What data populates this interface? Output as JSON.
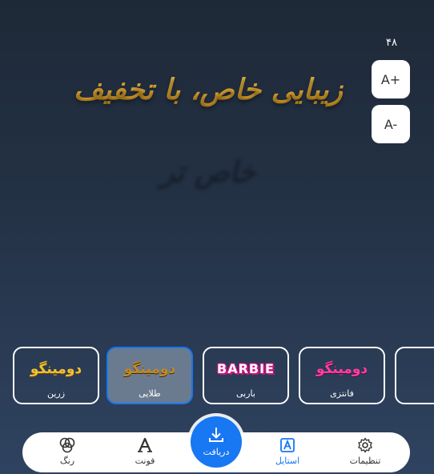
{
  "font_size": {
    "value": "۴۸",
    "increase_label": "A+",
    "decrease_label": "A-"
  },
  "preview": {
    "text": "زیبایی خاص، با تخفیف خاص تر"
  },
  "styles": [
    {
      "preview": "دومینگو",
      "label": "زرین"
    },
    {
      "preview": "دومینگو",
      "label": "طلایی"
    },
    {
      "preview": "BARBIE",
      "label": "باربی"
    },
    {
      "preview": "دومینگو",
      "label": "فانتزی"
    }
  ],
  "nav": {
    "color_label": "رنگ",
    "font_label": "فونت",
    "download_label": "دریافت",
    "style_label": "استایل",
    "settings_label": "تنظیمات"
  },
  "colors": {
    "accent": "#1877f2",
    "background_top": "#1e2937",
    "background_bottom": "#2f4360"
  },
  "icons": {
    "color": "palette-icon",
    "font": "font-icon",
    "download": "download-icon",
    "style": "style-icon",
    "settings": "gear-icon"
  }
}
